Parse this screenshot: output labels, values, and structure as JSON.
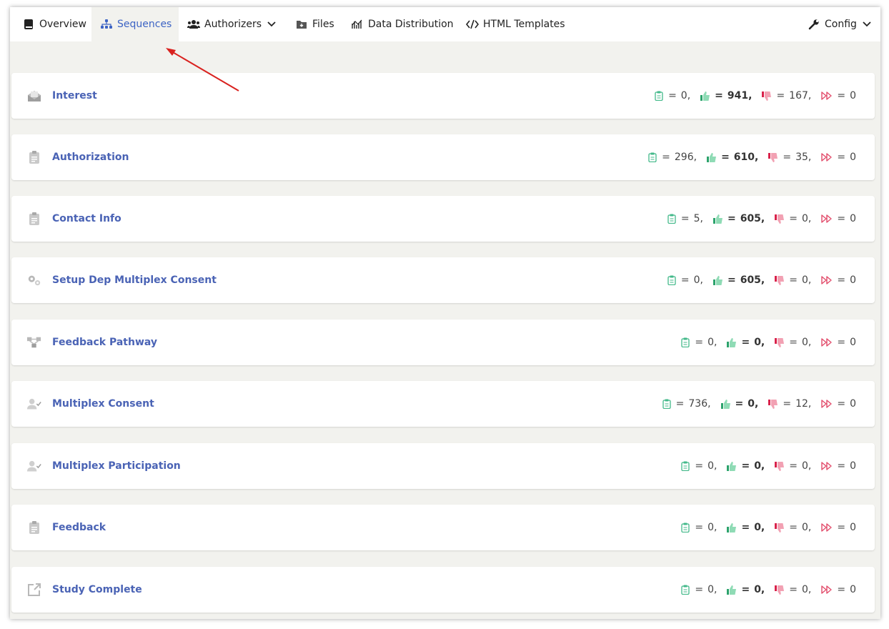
{
  "nav": {
    "items": [
      {
        "label": "Overview",
        "icon": "book-icon"
      },
      {
        "label": "Sequences",
        "icon": "sitemap-icon",
        "active": true
      },
      {
        "label": "Authorizers",
        "icon": "users-icon",
        "dropdown": true
      },
      {
        "label": "Files",
        "icon": "folder-download-icon"
      },
      {
        "label": "Data Distribution",
        "icon": "chart-line-icon"
      },
      {
        "label": "HTML Templates",
        "icon": "code-icon"
      }
    ],
    "config_label": "Config"
  },
  "colors": {
    "accent": "#3d64c4",
    "link": "#4a63b5",
    "pending": "#43b98a",
    "approved": "#43b98a",
    "rejected": "#e24b6a",
    "skipped": "#e24b6a"
  },
  "sequences": [
    {
      "name": "Interest",
      "icon": "envelope-open-icon",
      "pending": "0,",
      "approved": "941,",
      "rejected": "167,",
      "skipped": "0"
    },
    {
      "name": "Authorization",
      "icon": "clipboard-icon",
      "pending": "296,",
      "approved": "610,",
      "rejected": "35,",
      "skipped": "0"
    },
    {
      "name": "Contact Info",
      "icon": "clipboard-icon",
      "pending": "5,",
      "approved": "605,",
      "rejected": "0,",
      "skipped": "0"
    },
    {
      "name": "Setup Dep Multiplex Consent",
      "icon": "gears-icon",
      "pending": "0,",
      "approved": "605,",
      "rejected": "0,",
      "skipped": "0"
    },
    {
      "name": "Feedback Pathway",
      "icon": "diagram-icon",
      "pending": "0,",
      "approved": "0,",
      "rejected": "0,",
      "skipped": "0"
    },
    {
      "name": "Multiplex Consent",
      "icon": "user-check-icon",
      "pending": "736,",
      "approved": "0,",
      "rejected": "12,",
      "skipped": "0"
    },
    {
      "name": "Multiplex Participation",
      "icon": "user-check-icon",
      "pending": "0,",
      "approved": "0,",
      "rejected": "0,",
      "skipped": "0"
    },
    {
      "name": "Feedback",
      "icon": "clipboard-icon",
      "pending": "0,",
      "approved": "0,",
      "rejected": "0,",
      "skipped": "0"
    },
    {
      "name": "Study Complete",
      "icon": "external-link-icon",
      "pending": "0,",
      "approved": "0,",
      "rejected": "0,",
      "skipped": "0"
    }
  ]
}
